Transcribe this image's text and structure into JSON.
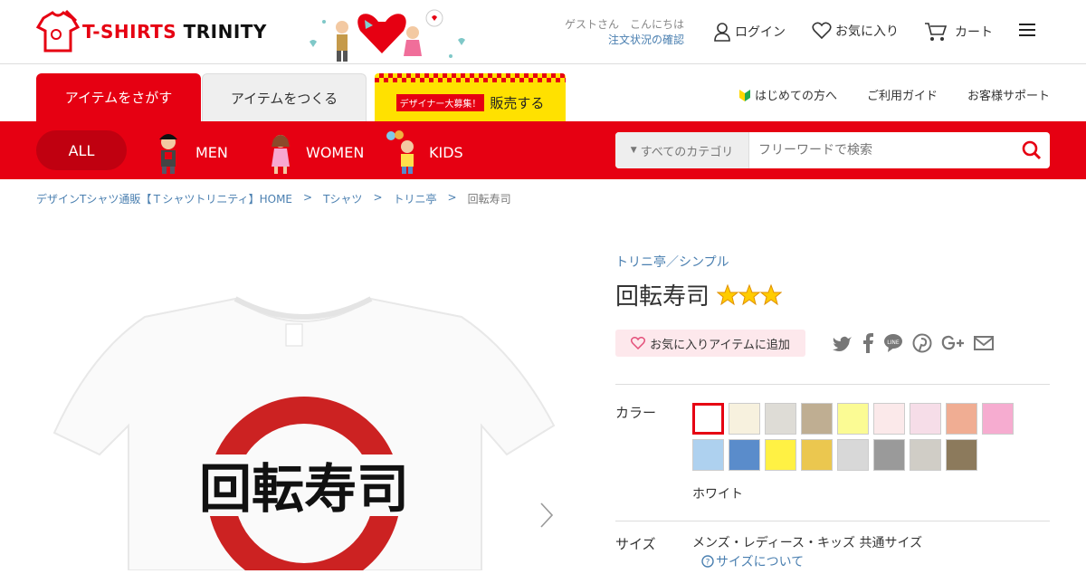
{
  "header": {
    "logo": {
      "part1": "T-SHIRTS",
      "part2": "TRINITY"
    },
    "greeting": {
      "line1": "ゲストさん　こんにちは",
      "line2": "注文状況の確認"
    },
    "login_label": "ログイン",
    "favorites_label": "お気に入り",
    "cart_label": "カート"
  },
  "tabs": {
    "search_items": "アイテムをさがす",
    "make_items": "アイテムをつくる",
    "sell_badge": "デザイナー大募集！",
    "sell_label": "販売する"
  },
  "sublinks": {
    "beginners": "はじめての方へ",
    "guide": "ご利用ガイド",
    "support": "お客様サポート"
  },
  "categories": {
    "all": "ALL",
    "men": "MEN",
    "women": "WOMEN",
    "kids": "KIDS"
  },
  "search": {
    "category": "すべてのカテゴリ",
    "placeholder": "フリーワードで検索"
  },
  "breadcrumb": [
    "デザインTシャツ通販【Ｔシャツトリニティ】HOME",
    "Tシャツ",
    "トリニ亭",
    "回転寿司"
  ],
  "breadcrumb_sep": ">",
  "product": {
    "maker": "トリニ亭／シンプル",
    "title": "回転寿司",
    "print_text": "回転寿司",
    "star_rating": 3,
    "fav_button": "お気に入りアイテムに追加",
    "color_label": "カラー",
    "selected_color": "ホワイト",
    "size_label": "サイズ",
    "size_value": "メンズ・レディース・キッズ 共通サイズ",
    "size_link": "サイズについて"
  },
  "colors": {
    "brand_red": "#e60012",
    "link_blue": "#4a7fb0",
    "sell_yellow": "#ffe100"
  },
  "swatches": [
    "#ffffff",
    "#f7f1de",
    "#dedcd6",
    "#bfae92",
    "#fbfb94",
    "#fbe9ea",
    "#f6dde8",
    "#f0ad93",
    "#f6acd0",
    "#aed1ef",
    "#5a8ccb",
    "#fff144",
    "#ebc74f",
    "#d8d8d8",
    "#9a9a9a",
    "#d0cdc6",
    "#8c7a5c"
  ]
}
